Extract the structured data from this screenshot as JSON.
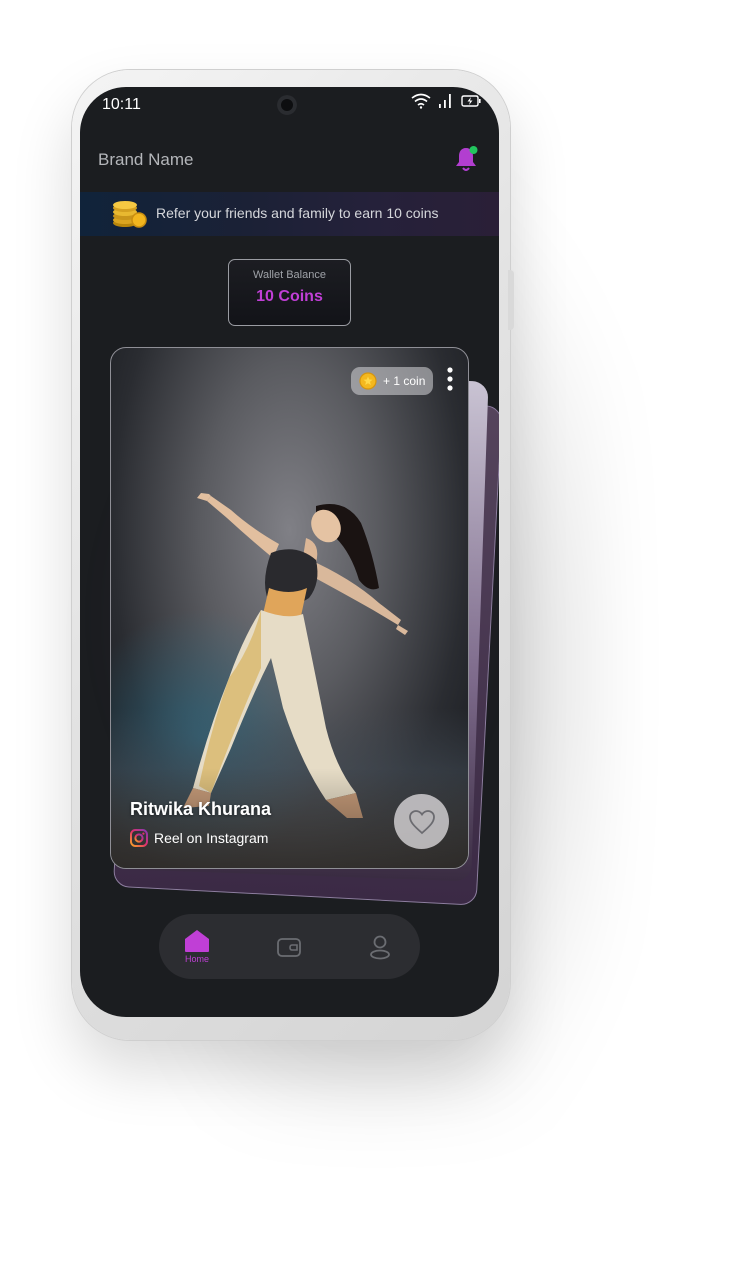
{
  "status_bar": {
    "time": "10:11"
  },
  "header": {
    "brand": "Brand Name"
  },
  "banner": {
    "text": "Refer your friends and family to earn 10 coins"
  },
  "wallet": {
    "label": "Wallet Balance",
    "value": "10 Coins"
  },
  "card": {
    "reward": "+ 1 coin",
    "name": "Ritwika Khurana",
    "source": "Reel on Instagram"
  },
  "nav": {
    "home_label": "Home"
  },
  "colors": {
    "accent": "#c03fd6",
    "notification_dot": "#22c55e",
    "screen_bg": "#1b1d20",
    "nav_bg": "#2c2d31"
  },
  "icons": [
    "wifi-icon",
    "signal-icon",
    "battery-icon",
    "bell-icon",
    "coins-icon",
    "coin-icon",
    "more-icon",
    "instagram-icon",
    "heart-icon",
    "home-icon",
    "wallet-icon",
    "profile-icon"
  ]
}
